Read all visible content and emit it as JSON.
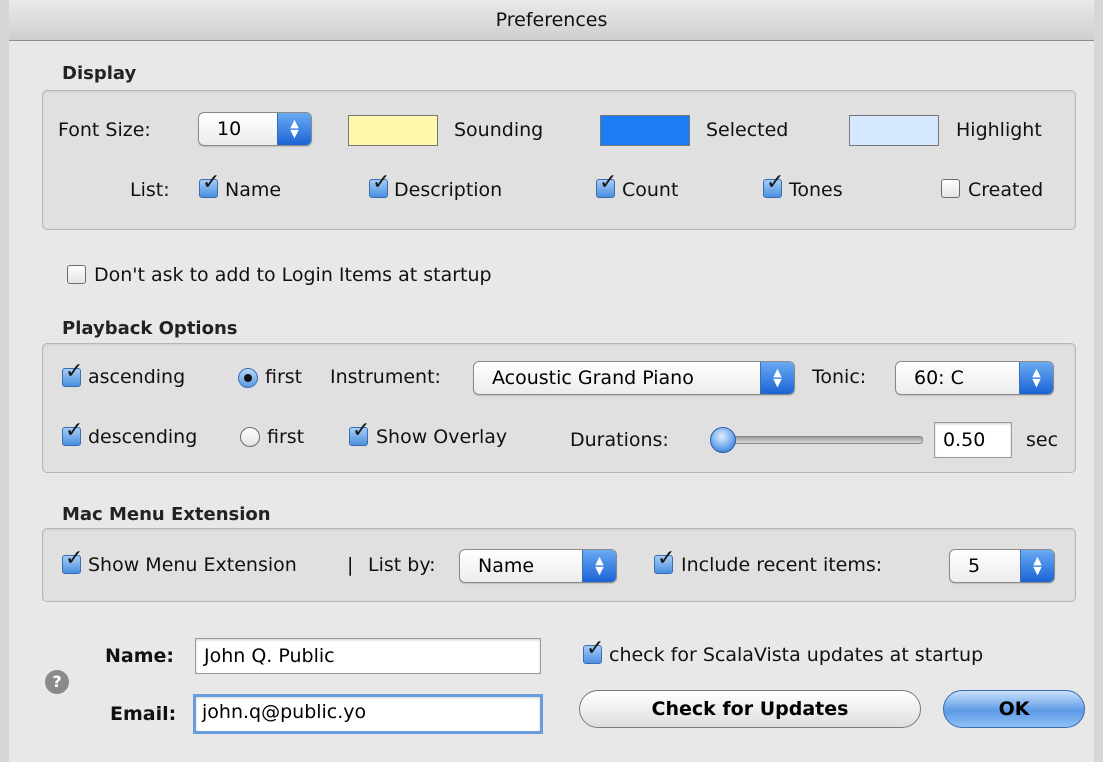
{
  "window": {
    "title": "Preferences"
  },
  "display": {
    "section_title": "Display",
    "font_size_label": "Font Size:",
    "font_size_value": "10",
    "colors": [
      {
        "label": "Sounding",
        "color": "#fff7aa"
      },
      {
        "label": "Selected",
        "color": "#1c7cf2"
      },
      {
        "label": "Highlight",
        "color": "#d6e8ff"
      }
    ],
    "list_label": "List:",
    "list_columns": [
      {
        "label": "Name",
        "checked": true
      },
      {
        "label": "Description",
        "checked": true
      },
      {
        "label": "Count",
        "checked": true
      },
      {
        "label": "Tones",
        "checked": true
      },
      {
        "label": "Created",
        "checked": false
      }
    ]
  },
  "login_items": {
    "label": "Don't ask to add to Login Items at startup",
    "checked": false
  },
  "playback": {
    "section_title": "Playback Options",
    "ascending_label": "ascending",
    "ascending_checked": true,
    "ascending_first_label": "first",
    "ascending_first_selected": true,
    "descending_label": "descending",
    "descending_checked": true,
    "descending_first_label": "first",
    "descending_first_selected": false,
    "instrument_label": "Instrument:",
    "instrument_value": "Acoustic Grand Piano",
    "tonic_label": "Tonic:",
    "tonic_value": "60: C",
    "show_overlay_label": "Show Overlay",
    "show_overlay_checked": true,
    "durations_label": "Durations:",
    "durations_value": "0.50",
    "durations_unit": "sec",
    "durations_slider_fraction": 0.05
  },
  "mac_menu": {
    "section_title": "Mac Menu Extension",
    "show_label": "Show Menu Extension",
    "show_checked": true,
    "separator": "|",
    "list_by_label": "List by:",
    "list_by_value": "Name",
    "include_recent_label": "Include recent items:",
    "include_recent_checked": true,
    "recent_count_value": "5"
  },
  "user": {
    "name_label": "Name:",
    "name_value": "John Q. Public",
    "email_label": "Email:",
    "email_value": "john.q@public.yo",
    "check_updates_label": "check for ScalaVista updates at startup",
    "check_updates_checked": true,
    "check_button_label": "Check for Updates",
    "ok_button_label": "OK",
    "help_glyph": "?"
  }
}
